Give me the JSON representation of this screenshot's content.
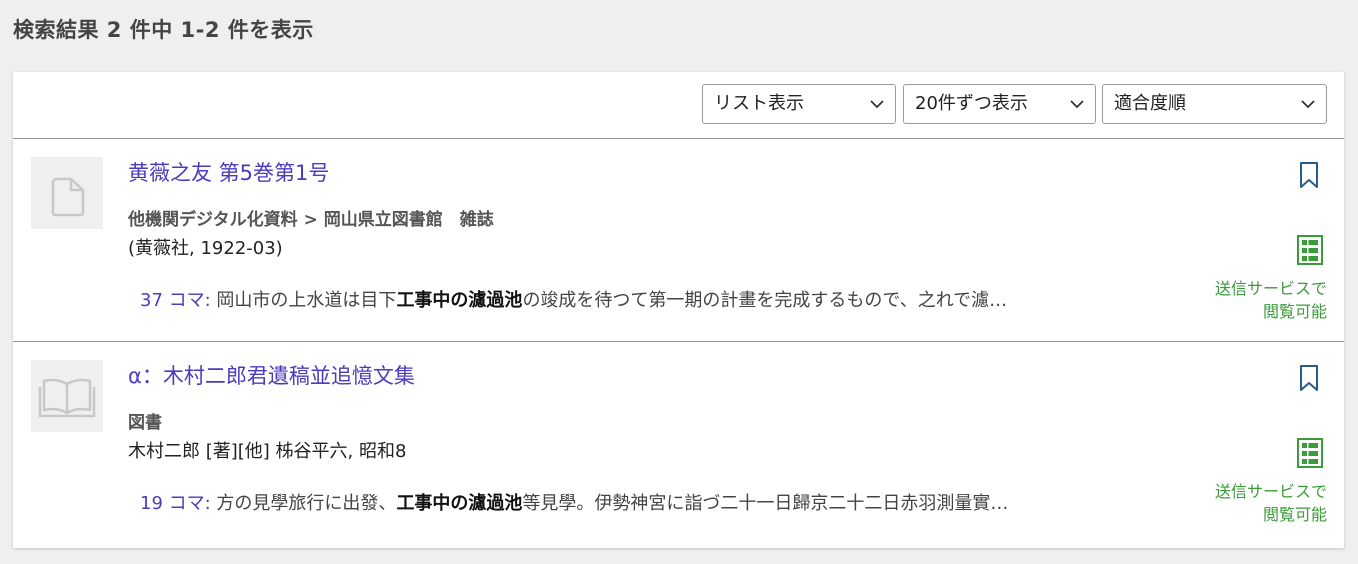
{
  "summary": "検索結果 2 件中 1-2 件を表示",
  "toolbar": {
    "view_select": "リスト表示",
    "per_page_select": "20件ずつ表示",
    "sort_select": "適合度順"
  },
  "results": [
    {
      "title": "黄薇之友 第5巻第1号",
      "meta": "他機関デジタル化資料 > 岡山県立図書館　雑誌",
      "publication": "(黄薇社, 1922-03)",
      "snippet_frame": "37 コマ:",
      "snippet_pre": " 岡山市の上水道は目下",
      "snippet_hit": "工事中の濾過池",
      "snippet_post": "の竣成を待つて第一期の計畫を完成するもので、之れで濾…",
      "service_line1": "送信サービスで",
      "service_line2": "閲覧可能",
      "thumb_icon": "document-icon"
    },
    {
      "title": "α：木村二郎君遺稿並追憶文集",
      "meta": "図書",
      "publication": "木村二郎 [著][他] 柹谷平六, 昭和8",
      "snippet_frame": "19 コマ:",
      "snippet_pre": " 方の見學旅行に出發、",
      "snippet_hit": "工事中の濾過池",
      "snippet_post": "等見學。伊勢神宮に詣づ二十一日歸京二十二日赤羽測量實…",
      "service_line1": "送信サービスで",
      "service_line2": "閲覧可能",
      "thumb_icon": "book-icon"
    }
  ],
  "colors": {
    "link": "#4a3cc0",
    "service": "#3a9b3a",
    "bookmark": "#2a5c8a"
  }
}
